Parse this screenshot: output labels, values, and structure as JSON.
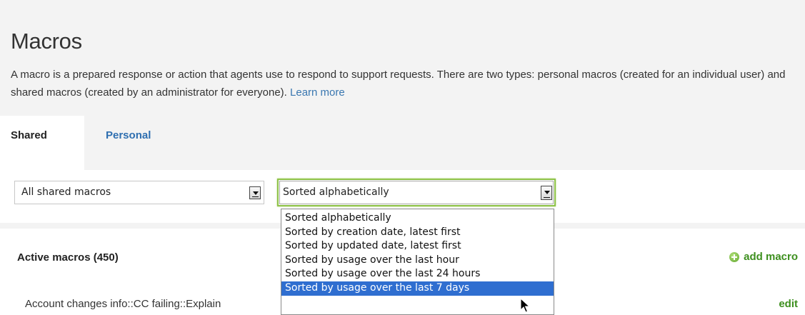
{
  "header": {
    "title": "Macros",
    "description": "A macro is a prepared response or action that agents use to respond to support requests. There are two types: personal macros (created for an individual user) and shared macros (created by an administrator for everyone).",
    "learn_more": "Learn more"
  },
  "tabs": [
    {
      "label": "Shared",
      "active": true
    },
    {
      "label": "Personal",
      "active": false
    }
  ],
  "filters": {
    "scope_value": "All shared macros",
    "sort_value": "Sorted alphabetically",
    "sort_options": [
      "Sorted alphabetically",
      "Sorted by creation date, latest first",
      "Sorted by updated date, latest first",
      "Sorted by usage over the last hour",
      "Sorted by usage over the last 24 hours",
      "Sorted by usage over the last 7 days"
    ],
    "highlighted_option": "Sorted by usage over the last 7 days"
  },
  "section": {
    "title": "Active macros (450)",
    "add_label": "add macro"
  },
  "rows": [
    {
      "name": "Account changes info::CC failing::Explain",
      "action": "edit"
    }
  ],
  "colors": {
    "link_blue": "#3a77b0",
    "action_green": "#3d8f1e",
    "focus_green": "#8fc24a",
    "selection_blue": "#2f6ed0"
  }
}
